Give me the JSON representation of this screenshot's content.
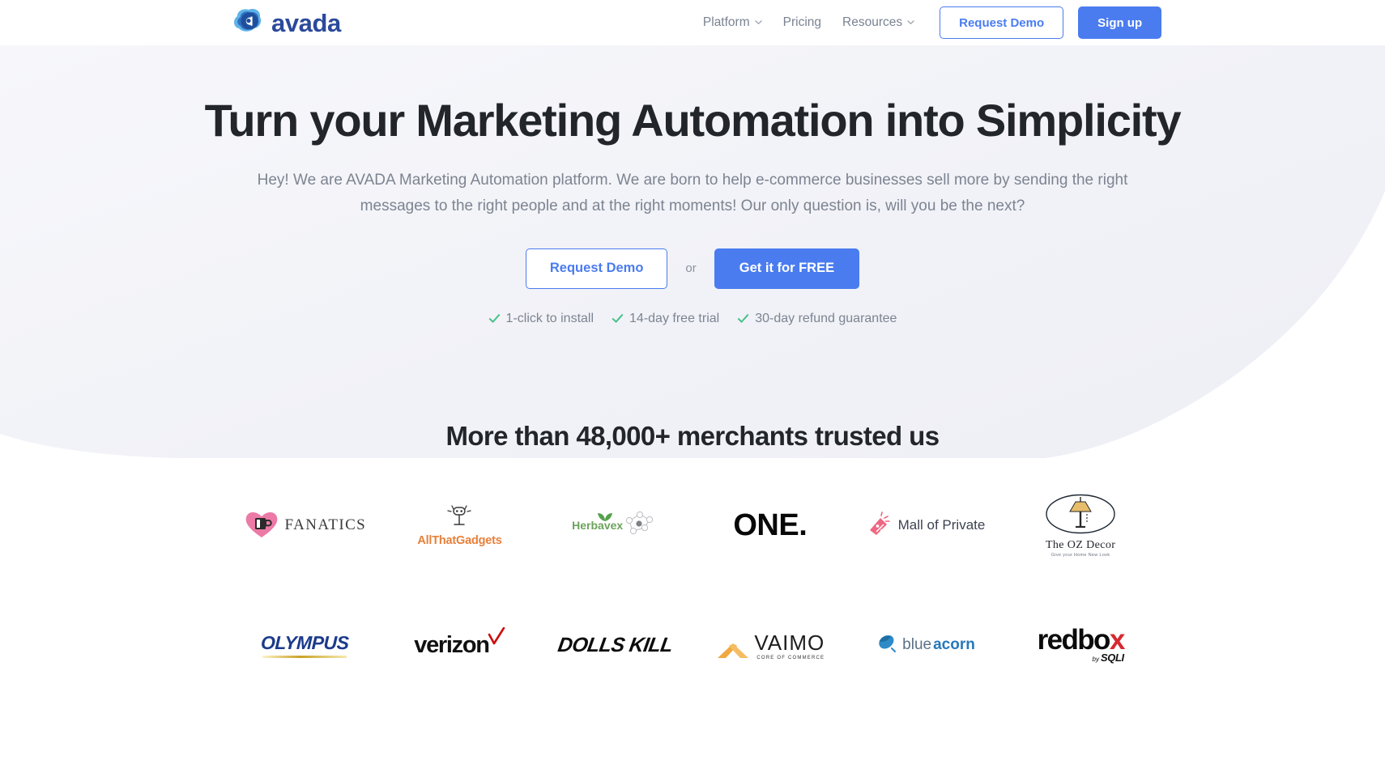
{
  "header": {
    "brand": {
      "name": "avada",
      "logo_icon": "avada-cloud-logo",
      "accent": "#2b4a9b"
    },
    "nav": [
      {
        "label": "Platform",
        "has_dropdown": true,
        "icon": "chevron-down-icon"
      },
      {
        "label": "Pricing",
        "has_dropdown": false
      },
      {
        "label": "Resources",
        "has_dropdown": true,
        "icon": "chevron-down-icon"
      }
    ],
    "request_demo_label": "Request Demo",
    "sign_up_label": "Sign up",
    "primary_color": "#4a7cf0"
  },
  "hero": {
    "title": "Turn your Marketing Automation into Simplicity",
    "subtitle": "Hey! We are AVADA Marketing Automation platform. We are born to help e-commerce businesses sell more by sending the right messages to the right people and at the right moments! Our only question is, will you be the next?",
    "cta_outline_label": "Request Demo",
    "or_label": "or",
    "cta_solid_label": "Get it for FREE",
    "features": [
      {
        "icon": "check-icon",
        "label": "1-click to install"
      },
      {
        "icon": "check-icon",
        "label": "14-day free trial"
      },
      {
        "icon": "check-icon",
        "label": "30-day refund guarantee"
      }
    ],
    "check_color": "#49c18a",
    "background_color": "#f1f2f7"
  },
  "merchants": {
    "title": "More than 48,000+ merchants trusted us",
    "logos": [
      {
        "name": "Fanatics",
        "text": "FANATICS",
        "icon": "heart-mug-icon",
        "color": "#e8699b"
      },
      {
        "name": "AllThatGadgets",
        "text": "AllThatGadgets",
        "icon": "gadget-icon",
        "color": "#e8803a"
      },
      {
        "name": "Herbavex",
        "text": "Herbavex",
        "icon": "leaf-molecule-icon",
        "color": "#6ca35c"
      },
      {
        "name": "ONE",
        "text": "ONE.",
        "icon": "none",
        "color": "#080808"
      },
      {
        "name": "Mall of Private",
        "text": "Mall of Private",
        "icon": "percent-tag-icon",
        "color": "#3d4352"
      },
      {
        "name": "The OZ Decor",
        "text": "The OZ Decor",
        "tagline": "Give your Home New Look",
        "icon": "lamp-oval-icon",
        "color": "#23272e"
      },
      {
        "name": "Olympus",
        "text": "OLYMPUS",
        "icon": "none",
        "color": "#1b3a8c"
      },
      {
        "name": "Verizon",
        "text": "verizon",
        "icon": "red-check-icon",
        "color": "#111111"
      },
      {
        "name": "Dolls Kill",
        "text": "DOLLS KILL",
        "icon": "none",
        "color": "#0d0d0d"
      },
      {
        "name": "Vaimo",
        "text": "VAIMO",
        "tagline": "CORE OF COMMERCE",
        "icon": "orange-x-icon",
        "color": "#f0a840"
      },
      {
        "name": "Blue Acorn",
        "text_light": "blue",
        "text_bold": "acorn",
        "icon": "acorn-icon",
        "color": "#2779b8"
      },
      {
        "name": "Redbox",
        "text": "redbo",
        "text_accent": "x",
        "by_prefix": "by",
        "by_brand": "SQLI",
        "icon": "none",
        "color": "#d7282f"
      }
    ]
  }
}
